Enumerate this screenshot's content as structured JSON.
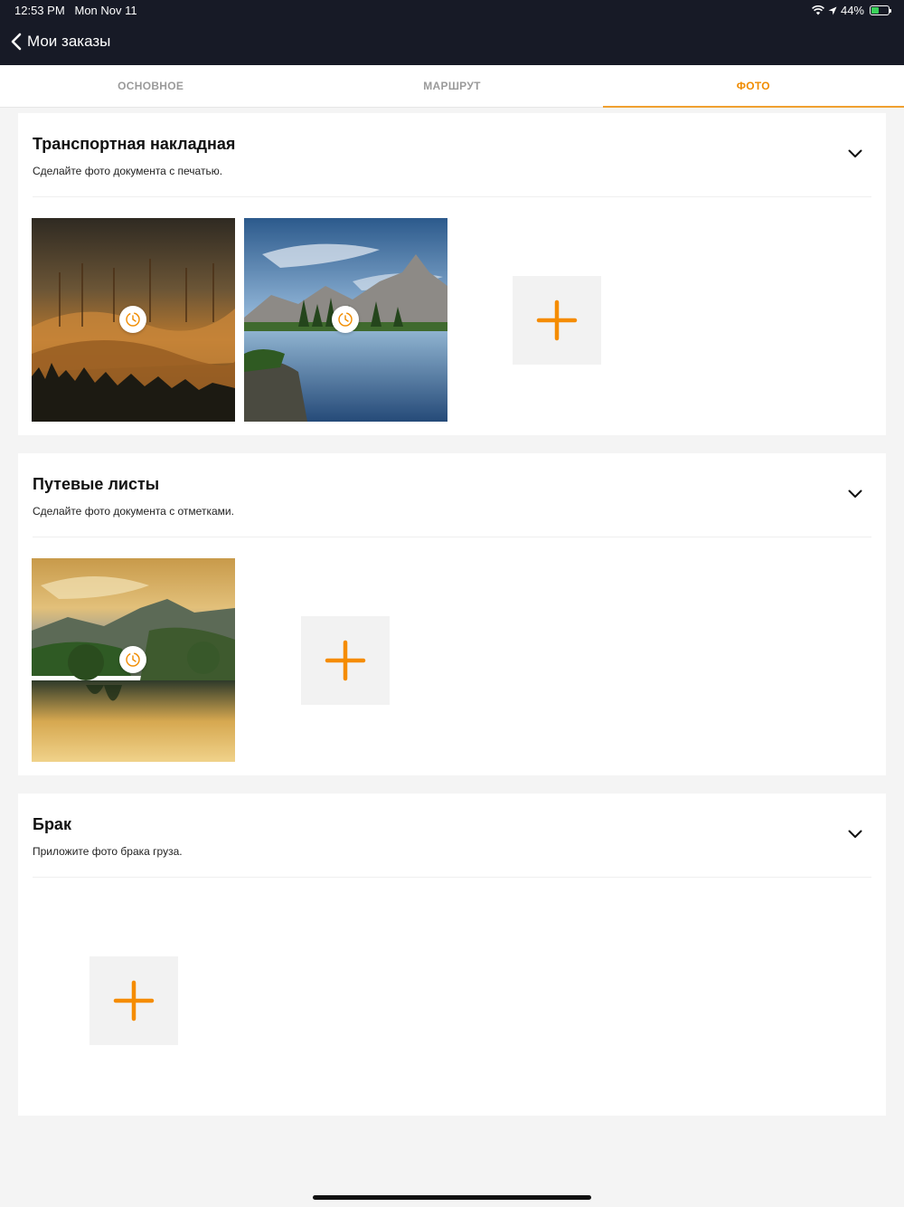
{
  "status": {
    "time": "12:53 PM",
    "date": "Mon Nov 11",
    "battery": "44%",
    "battery_level": 0.44
  },
  "nav": {
    "back_title": "Мои заказы"
  },
  "tabs": [
    {
      "label": "ОСНОВНОЕ",
      "active": false
    },
    {
      "label": "МАРШРУТ",
      "active": false
    },
    {
      "label": "ФОТО",
      "active": true
    }
  ],
  "sections": [
    {
      "title": "Транспортная накладная",
      "subtitle": "Сделайте фото документа с печатью.",
      "photos": 2
    },
    {
      "title": "Путевые листы",
      "subtitle": "Сделайте фото документа с отметками.",
      "photos": 1
    },
    {
      "title": "Брак",
      "subtitle": "Приложите фото брака груза.",
      "photos": 0
    }
  ],
  "colors": {
    "accent": "#f08c00",
    "topbar": "#171a26"
  }
}
